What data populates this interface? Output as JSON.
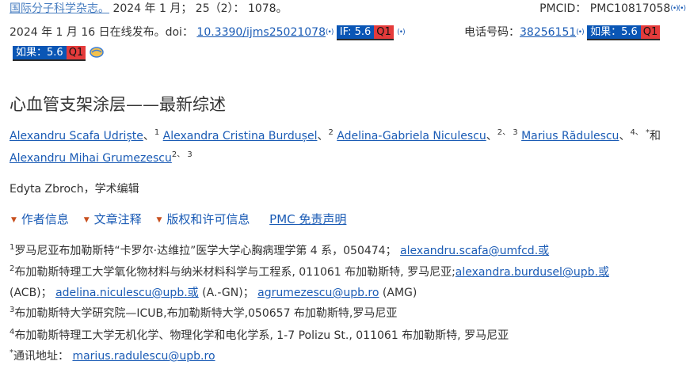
{
  "header": {
    "journal": "国际分子科学杂志。",
    "citation": "2024 年 1 月； 25（2）： 1078。",
    "pmcid": "PMCID： PMC10817058",
    "published": "2024 年 1 月 16 日在线发布。doi：",
    "doi": "10.3390/ijms25021078",
    "if_badge": "IF: 5.6",
    "q_badge": "Q1",
    "phone_label": "电话号码：",
    "phone_value": "38256151",
    "ifcn_badge": "如果：5.6",
    "ifcn_badge2": "如果：5.6",
    "radio_glyph": "(•)"
  },
  "title": "心血管支架涂层——最新综述",
  "authors": [
    {
      "name": "Alexandru Scafa Udriște",
      "sup": "1"
    },
    {
      "name": "Alexandra Cristina Burdușel",
      "sup": "2"
    },
    {
      "name": "Adelina-Gabriela Niculescu",
      "sup": "2、 3"
    },
    {
      "name": "Marius Rădulescu",
      "sup": "4、 *"
    },
    {
      "name": "Alexandru Mihai Grumezescu",
      "sup": "2、 3"
    }
  ],
  "authors_sep": "、",
  "authors_and": "和",
  "editor": "Edyta Zbroch，学术编辑",
  "tabs": [
    "作者信息",
    "文章注释",
    "版权和许可信息"
  ],
  "disclaimer": "PMC 免责声明",
  "affiliations": {
    "a1_sup": "1",
    "a1_text": "罗马尼亚布加勒斯特“卡罗尔·达维拉”医学大学心胸病理学第 4 系，050474；",
    "a1_email": "alexandru.scafa@umfcd.或",
    "a2_sup": "2",
    "a2_text": "布加勒斯特理工大学氧化物材料与纳米材料科学与工程系, 011061 布加勒斯特, 罗马尼亚;",
    "a2_email1": "alexandra.burdusel@upb.或",
    "a2_text2": "(ACB)；",
    "a2_email2": "adelina.niculescu@upb.或",
    "a2_text3": "(A.-GN)；",
    "a2_email3": "agrumezescu@upb.ro",
    "a2_text4": "(AMG)",
    "a3_sup": "3",
    "a3_text": "布加勒斯特大学研究院—ICUB,布加勒斯特大学,050657 布加勒斯特,罗马尼亚",
    "a4_sup": "4",
    "a4_text": "布加勒斯特理工大学无机化学、物理化学和电化学系, 1-7 Polizu St., 011061 布加勒斯特, 罗马尼亚",
    "corr_sup": "*",
    "corr_label": "通讯地址：",
    "corr_email": "marius.radulescu@upb.ro"
  },
  "colors": {
    "link": "#1a5bb5",
    "if_badge_bg": "#0a56b5",
    "q_badge_bg": "#e43b3b",
    "triangle": "#c8501f"
  }
}
